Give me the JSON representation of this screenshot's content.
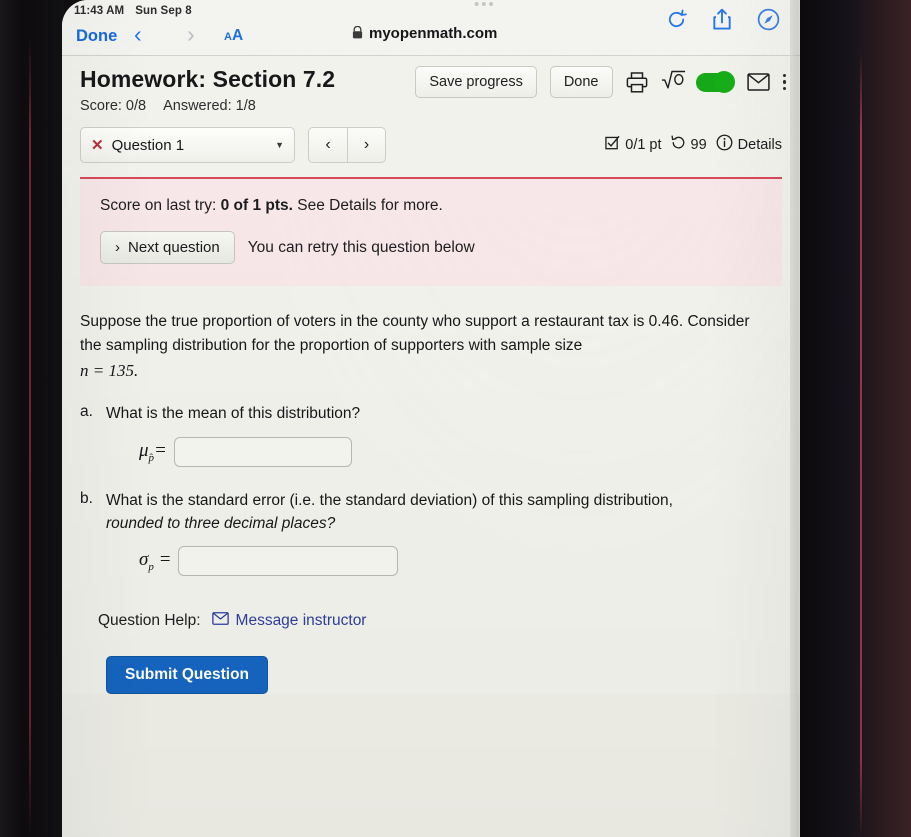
{
  "status_bar": {
    "time": "11:43 AM",
    "date": "Sun Sep 8",
    "ellipsis": "•••"
  },
  "browser": {
    "done_label": "Done",
    "back_icon": "‹",
    "forward_icon": "›",
    "aa_small": "A",
    "aa_big": "A",
    "lock_icon": "🔒",
    "url": "myopenmath.com",
    "icons": [
      "reload-icon",
      "share-icon",
      "safari-compass-icon"
    ]
  },
  "header": {
    "title": "Homework: Section 7.2",
    "score_label": "Score: 0/8",
    "answered_label": "Answered: 1/8",
    "save_progress_label": "Save progress",
    "done_label": "Done",
    "print_icon": "printer-icon",
    "sqrt_label": "√0",
    "math_toggle_on": true,
    "mail_icon": "envelope-icon",
    "menu_icon": "kebab-menu-icon"
  },
  "qnav": {
    "x_mark": "✕",
    "question_label": "Question 1",
    "caret": "▼",
    "prev_label": "‹",
    "next_label": "›",
    "points_label": "0/1 pt",
    "attempts_label": "99",
    "details_label": "Details",
    "checkbox_icon": "checkbox-icon",
    "retry_icon": "retry-arrow-icon",
    "info_icon": "info-circle-icon",
    "divider_color": "#d9485c"
  },
  "alert": {
    "background": "#f7e7e9",
    "score_prefix": "Score on last try: ",
    "score_bold": "0 of 1 pts.",
    "score_suffix": " See Details for more.",
    "next_question_label": "Next question",
    "next_chevron": "›",
    "retry_text": "You can retry this question below"
  },
  "question": {
    "paragraph_line1": "Suppose the true proportion of voters in the county who support a restaurant tax is 0.46.",
    "paragraph_line2": "Consider the sampling distribution for the proportion of supporters with sample size",
    "sample_size_math": "n = 135.",
    "parts": [
      {
        "letter": "a.",
        "prompt": "What is the mean of this distribution?",
        "prompt_italic": "",
        "answer_symbol": "μ",
        "answer_subscript": "p̂",
        "answer_equals": "=",
        "answer_value": "",
        "input_width": "narrow"
      },
      {
        "letter": "b.",
        "prompt": "What is the standard error (i.e. the standard deviation) of this sampling distribution,",
        "prompt_italic": "rounded to three decimal places?",
        "answer_symbol": "σ",
        "answer_subscript": "p",
        "answer_equals": "=",
        "answer_value": "",
        "input_width": "wide"
      }
    ]
  },
  "footer": {
    "help_label": "Question Help:",
    "message_instructor_label": "Message instructor",
    "message_icon": "envelope-icon",
    "submit_label": "Submit Question",
    "submit_color": "#1565c0"
  }
}
